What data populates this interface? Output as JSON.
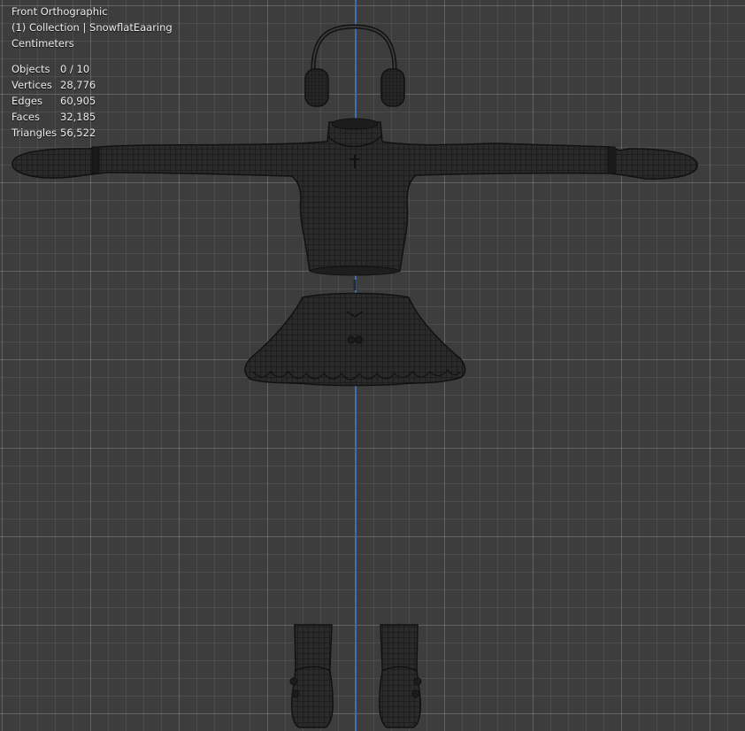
{
  "viewport": {
    "view_name": "Front Orthographic",
    "collection": "(1) Collection | SnowflatEaaring",
    "units": "Centimeters",
    "stats": [
      {
        "label": "Objects",
        "value": "0 / 10"
      },
      {
        "label": "Vertices",
        "value": "28,776"
      },
      {
        "label": "Edges",
        "value": "60,905"
      },
      {
        "label": "Faces",
        "value": "32,185"
      },
      {
        "label": "Triangles",
        "value": "56,522"
      }
    ]
  },
  "colors": {
    "background": "#3d3d3d",
    "grid_line": "#4a4a4a",
    "z_axis": "#3f6fb0",
    "mesh_fill": "#2a2a2a",
    "mesh_wire": "#111111"
  }
}
